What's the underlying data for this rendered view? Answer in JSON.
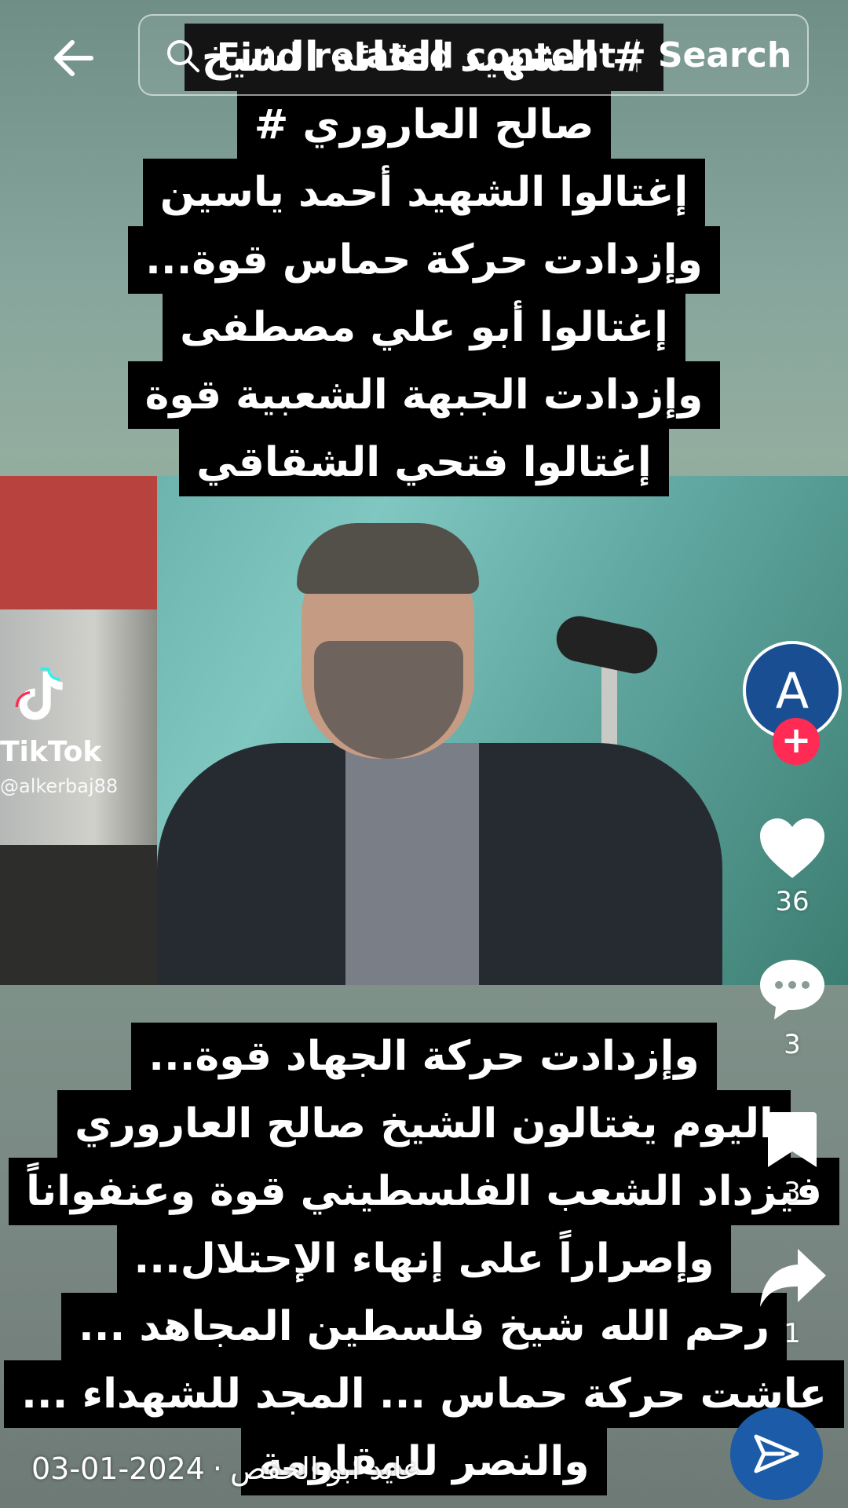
{
  "search": {
    "placeholder": "Find related content",
    "button_label": "Search"
  },
  "caption_top": {
    "lines": [
      "# الشهيد القائد الشيخ",
      "صالح العاروري #",
      "إغتالوا الشهيد أحمد ياسين",
      "وإزدادت حركة حماس قوة...",
      "إغتالوا أبو علي مصطفى",
      "وإزدادت الجبهة الشعبية قوة",
      "إغتالوا فتحي الشقاقي"
    ]
  },
  "caption_bottom": {
    "lines": [
      "وإزدادت حركة الجهاد قوة...",
      "اليوم يغتالون الشيخ صالح العاروري",
      "فيزداد الشعب الفلسطيني قوة وعنفواناً",
      "وإصراراً على إنهاء الإحتلال...",
      "رحم الله شيخ فلسطين المجاهد ...",
      "عاشت حركة حماس ... المجد للشهداء ...",
      "والنصر للمقاومة"
    ]
  },
  "watermark": {
    "brand": "TikTok",
    "username": "alkerbaj88"
  },
  "rail": {
    "avatar_letter": "A",
    "follow_symbol": "+",
    "likes": "36",
    "comments": "3",
    "saves": "3",
    "shares": "1"
  },
  "footer": {
    "author": "عايد ابو الحفص",
    "date": "2024-01-03"
  },
  "icons": {
    "back": "arrow-left-icon",
    "search": "magnifier-icon",
    "like": "heart-icon",
    "comment": "comment-bubble-icon",
    "save": "bookmark-icon",
    "share": "share-arrow-icon",
    "send": "paper-plane-icon"
  },
  "colors": {
    "follow": "#ff2b55",
    "avatar": "#1a4e93",
    "send": "#1b5ba7"
  }
}
